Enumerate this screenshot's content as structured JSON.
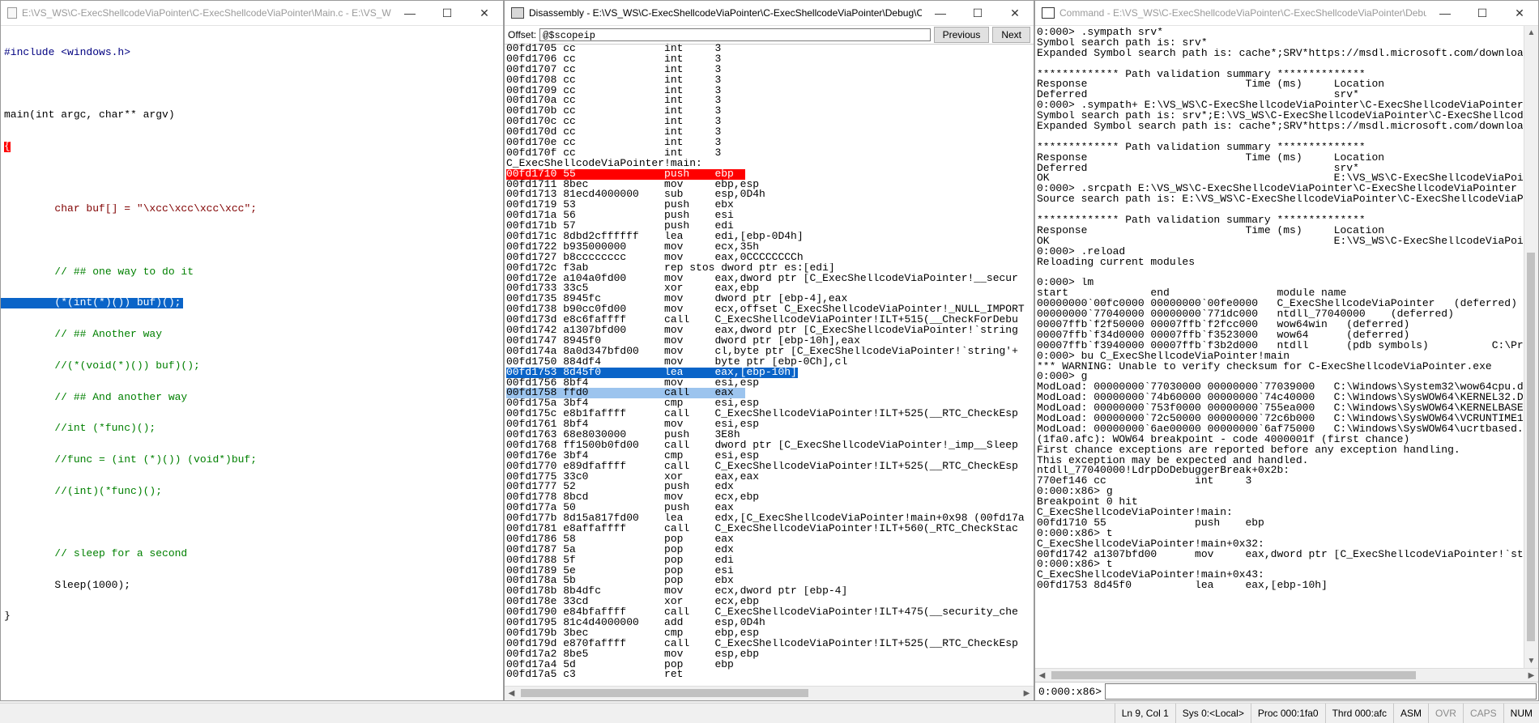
{
  "source_window": {
    "title": "E:\\VS_WS\\C-ExecShellcodeViaPointer\\C-ExecShellcodeViaPointer\\Main.c - E:\\VS_WS\\...",
    "lines": [
      "#include <windows.h>",
      "",
      "main(int argc, char** argv)",
      "{",
      "",
      "        char buf[] = \"\\xcc\\xcc\\xcc\\xcc\";",
      "",
      "        // ## one way to do it",
      "        (*(int(*)()) buf)();",
      "        // ## Another way",
      "        //(*(void(*)()) buf)();",
      "        // ## And another way",
      "        //int (*func)();",
      "        //func = (int (*)()) (void*)buf;",
      "        //(int)(*func)();",
      "",
      "        // sleep for a second",
      "        Sleep(1000);",
      "}"
    ]
  },
  "disasm_window": {
    "title": "Disassembly - E:\\VS_WS\\C-ExecShellcodeViaPointer\\C-ExecShellcodeViaPointer\\Debug\\C-...",
    "offset_label": "Offset:",
    "offset_value": "@$scopeip",
    "prev_label": "Previous",
    "next_label": "Next",
    "lines": [
      "00fd1705 cc              int     3",
      "00fd1706 cc              int     3",
      "00fd1707 cc              int     3",
      "00fd1708 cc              int     3",
      "00fd1709 cc              int     3",
      "00fd170a cc              int     3",
      "00fd170b cc              int     3",
      "00fd170c cc              int     3",
      "00fd170d cc              int     3",
      "00fd170e cc              int     3",
      "00fd170f cc              int     3",
      "C_ExecShellcodeViaPointer!main:",
      "00fd1710 55              push    ebp",
      "00fd1711 8bec            mov     ebp,esp",
      "00fd1713 81ecd4000000    sub     esp,0D4h",
      "00fd1719 53              push    ebx",
      "00fd171a 56              push    esi",
      "00fd171b 57              push    edi",
      "00fd171c 8dbd2cffffff    lea     edi,[ebp-0D4h]",
      "00fd1722 b935000000      mov     ecx,35h",
      "00fd1727 b8cccccccc      mov     eax,0CCCCCCCCh",
      "00fd172c f3ab            rep stos dword ptr es:[edi]",
      "00fd172e a104a0fd00      mov     eax,dword ptr [C_ExecShellcodeViaPointer!__secur",
      "00fd1733 33c5            xor     eax,ebp",
      "00fd1735 8945fc          mov     dword ptr [ebp-4],eax",
      "00fd1738 b90cc0fd00      mov     ecx,offset C_ExecShellcodeViaPointer!_NULL_IMPORT",
      "00fd173d e8c6faffff      call    C_ExecShellcodeViaPointer!ILT+515(__CheckForDebu",
      "00fd1742 a1307bfd00      mov     eax,dword ptr [C_ExecShellcodeViaPointer!`string",
      "00fd1747 8945f0          mov     dword ptr [ebp-10h],eax",
      "00fd174a 8a0d347bfd00    mov     cl,byte ptr [C_ExecShellcodeViaPointer!`string'+",
      "00fd1750 884df4          mov     byte ptr [ebp-0Ch],cl",
      "00fd1753 8d45f0          lea     eax,[ebp-10h]",
      "00fd1756 8bf4            mov     esi,esp",
      "00fd1758 ffd0            call    eax",
      "00fd175a 3bf4            cmp     esi,esp",
      "00fd175c e8b1faffff      call    C_ExecShellcodeViaPointer!ILT+525(__RTC_CheckEsp",
      "00fd1761 8bf4            mov     esi,esp",
      "00fd1763 68e8030000      push    3E8h",
      "00fd1768 ff1500b0fd00    call    dword ptr [C_ExecShellcodeViaPointer!_imp__Sleep",
      "00fd176e 3bf4            cmp     esi,esp",
      "00fd1770 e89dfaffff      call    C_ExecShellcodeViaPointer!ILT+525(__RTC_CheckEsp",
      "00fd1775 33c0            xor     eax,eax",
      "00fd1777 52              push    edx",
      "00fd1778 8bcd            mov     ecx,ebp",
      "00fd177a 50              push    eax",
      "00fd177b 8d15a817fd00    lea     edx,[C_ExecShellcodeViaPointer!main+0x98 (00fd17a",
      "00fd1781 e8affaffff      call    C_ExecShellcodeViaPointer!ILT+560(_RTC_CheckStac",
      "00fd1786 58              pop     eax",
      "00fd1787 5a              pop     edx",
      "00fd1788 5f              pop     edi",
      "00fd1789 5e              pop     esi",
      "00fd178a 5b              pop     ebx",
      "00fd178b 8b4dfc          mov     ecx,dword ptr [ebp-4]",
      "00fd178e 33cd            xor     ecx,ebp",
      "00fd1790 e84bfaffff      call    C_ExecShellcodeViaPointer!ILT+475(__security_che",
      "00fd1795 81c4d4000000    add     esp,0D4h",
      "00fd179b 3bec            cmp     ebp,esp",
      "00fd179d e870faffff      call    C_ExecShellcodeViaPointer!ILT+525(__RTC_CheckEsp",
      "00fd17a2 8be5            mov     esp,ebp",
      "00fd17a4 5d              pop     ebp",
      "00fd17a5 c3              ret"
    ]
  },
  "cmd_window": {
    "title": "Command - E:\\VS_WS\\C-ExecShellcodeViaPointer\\C-ExecShellcodeViaPointer\\Debu...",
    "prompt": "0:000:x86>",
    "lines": [
      "0:000> .sympath srv*",
      "Symbol search path is: srv*",
      "Expanded Symbol search path is: cache*;SRV*https://msdl.microsoft.com/downloa",
      "",
      "************* Path validation summary **************",
      "Response                         Time (ms)     Location",
      "Deferred                                       srv*",
      "0:000> .sympath+ E:\\VS_WS\\C-ExecShellcodeViaPointer\\C-ExecShellcodeViaPointer\\",
      "Symbol search path is: srv*;E:\\VS_WS\\C-ExecShellcodeViaPointer\\C-ExecShellcod",
      "Expanded Symbol search path is: cache*;SRV*https://msdl.microsoft.com/downloa",
      "",
      "************* Path validation summary **************",
      "Response                         Time (ms)     Location",
      "Deferred                                       srv*",
      "OK                                             E:\\VS_WS\\C-ExecShellcodeViaPoi",
      "0:000> .srcpath E:\\VS_WS\\C-ExecShellcodeViaPointer\\C-ExecShellcodeViaPointer",
      "Source search path is: E:\\VS_WS\\C-ExecShellcodeViaPointer\\C-ExecShellcodeViaP",
      "",
      "************* Path validation summary **************",
      "Response                         Time (ms)     Location",
      "OK                                             E:\\VS_WS\\C-ExecShellcodeViaPoi",
      "0:000> .reload",
      "Reloading current modules",
      "",
      "0:000> lm",
      "start             end                 module name",
      "00000000`00fc0000 00000000`00fe0000   C_ExecShellcodeViaPointer   (deferred)",
      "00000000`77040000 00000000`771dc000   ntdll_77040000    (deferred)",
      "00007ffb`f2f50000 00007ffb`f2fcc000   wow64win   (deferred)",
      "00007ffb`f34d0000 00007ffb`f3523000   wow64      (deferred)",
      "00007ffb`f3940000 00007ffb`f3b2d000   ntdll      (pdb symbols)          C:\\Pro",
      "0:000> bu C_ExecShellcodeViaPointer!main",
      "*** WARNING: Unable to verify checksum for C-ExecShellcodeViaPointer.exe",
      "0:000> g",
      "ModLoad: 00000000`77030000 00000000`77039000   C:\\Windows\\System32\\wow64cpu.d",
      "ModLoad: 00000000`74b60000 00000000`74c40000   C:\\Windows\\SysWOW64\\KERNEL32.D",
      "ModLoad: 00000000`753f0000 00000000`755ea000   C:\\Windows\\SysWOW64\\KERNELBASE",
      "ModLoad: 00000000`72c50000 00000000`72c6b000   C:\\Windows\\SysWOW64\\VCRUNTIME1",
      "ModLoad: 00000000`6ae00000 00000000`6af75000   C:\\Windows\\SysWOW64\\ucrtbased.d",
      "(1fa0.afc): WOW64 breakpoint - code 4000001f (first chance)",
      "First chance exceptions are reported before any exception handling.",
      "This exception may be expected and handled.",
      "ntdll_77040000!LdrpDoDebuggerBreak+0x2b:",
      "770ef146 cc              int     3",
      "0:000:x86> g",
      "Breakpoint 0 hit",
      "C_ExecShellcodeViaPointer!main:",
      "00fd1710 55              push    ebp",
      "0:000:x86> t",
      "C_ExecShellcodeViaPointer!main+0x32:",
      "00fd1742 a1307bfd00      mov     eax,dword ptr [C_ExecShellcodeViaPointer!`st",
      "0:000:x86> t",
      "C_ExecShellcodeViaPointer!main+0x43:",
      "00fd1753 8d45f0          lea     eax,[ebp-10h]"
    ]
  },
  "status": {
    "position": "Ln 9, Col 1",
    "sys": "Sys 0:<Local>",
    "proc": "Proc 000:1fa0",
    "thrd": "Thrd 000:afc",
    "asm": "ASM",
    "ovr": "OVR",
    "caps": "CAPS",
    "num": "NUM"
  }
}
